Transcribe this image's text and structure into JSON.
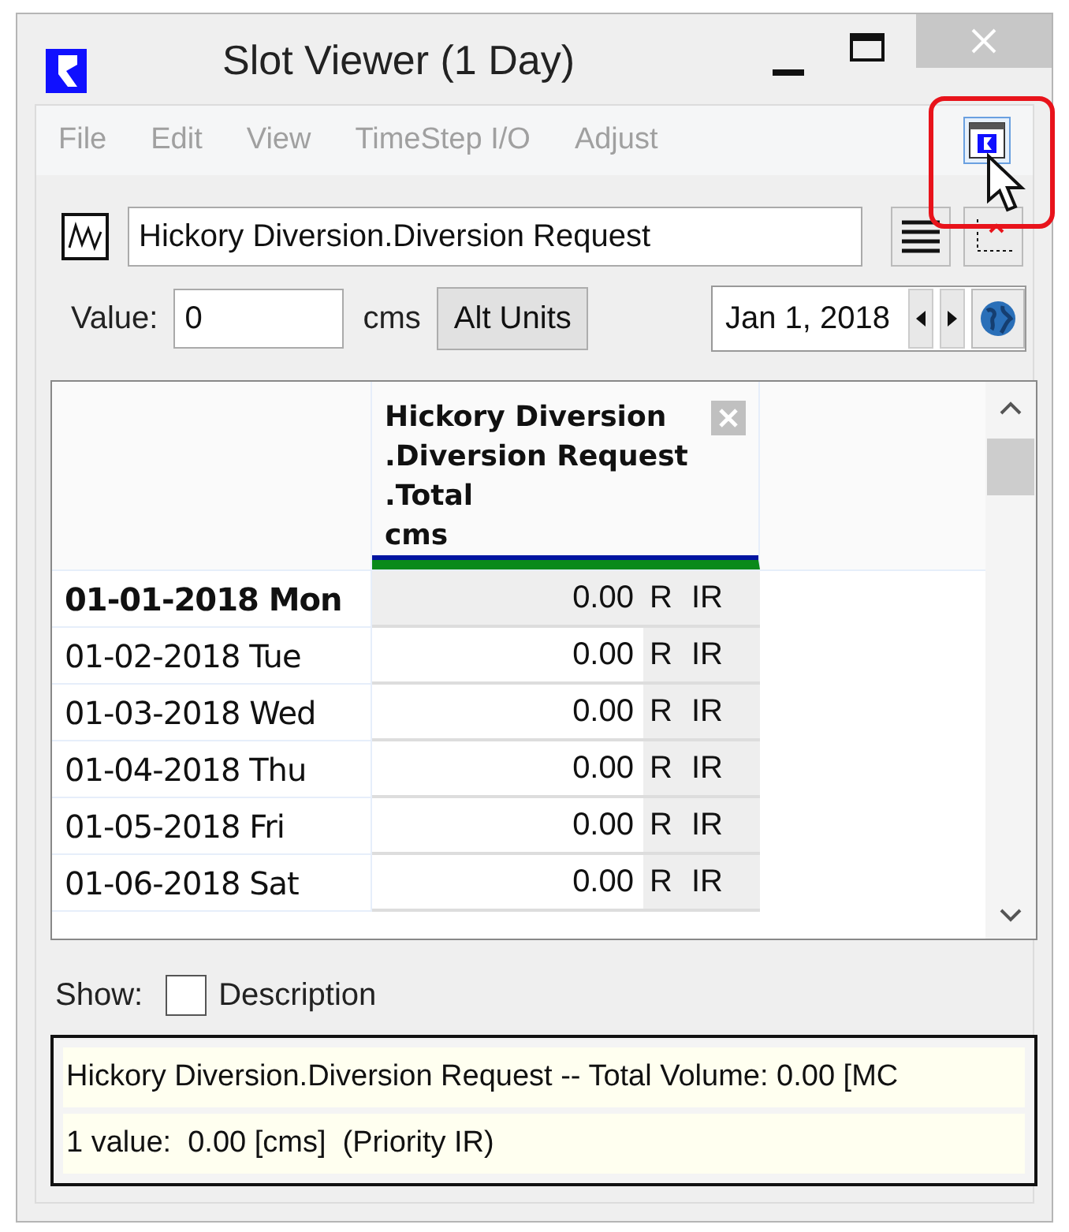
{
  "window": {
    "title": "Slot Viewer (1 Day)"
  },
  "menu": [
    {
      "label": "File",
      "disabled": true
    },
    {
      "label": "Edit",
      "disabled": true
    },
    {
      "label": "View",
      "disabled": true
    },
    {
      "label": "TimeStep I/O",
      "disabled": true
    },
    {
      "label": "Adjust",
      "disabled": true
    }
  ],
  "slot": {
    "value": "Hickory Diversion.Diversion Request"
  },
  "value_row": {
    "label": "Value:",
    "value": "0",
    "units": "cms",
    "alt_units_button": "Alt Units",
    "date": "Jan 1, 2018"
  },
  "table": {
    "column_header": [
      "Hickory Diversion",
      ".Diversion Request",
      ".Total",
      "cms"
    ],
    "rows": [
      {
        "date": "01-01-2018 Mon",
        "value": "0.00",
        "flag": "R",
        "priority": "IR",
        "selected": true
      },
      {
        "date": "01-02-2018 Tue",
        "value": "0.00",
        "flag": "R",
        "priority": "IR",
        "selected": false
      },
      {
        "date": "01-03-2018 Wed",
        "value": "0.00",
        "flag": "R",
        "priority": "IR",
        "selected": false
      },
      {
        "date": "01-04-2018 Thu",
        "value": "0.00",
        "flag": "R",
        "priority": "IR",
        "selected": false
      },
      {
        "date": "01-05-2018 Fri",
        "value": "0.00",
        "flag": "R",
        "priority": "IR",
        "selected": false
      },
      {
        "date": "01-06-2018 Sat",
        "value": "0.00",
        "flag": "R",
        "priority": "IR",
        "selected": false
      }
    ]
  },
  "show": {
    "label": "Show:",
    "description": {
      "label": "Description",
      "checked": false
    }
  },
  "status": [
    "Hickory Diversion.Diversion Request -- Total Volume: 0.00 [MC",
    "1 value:  0.00 [cms]  (Priority IR)"
  ]
}
